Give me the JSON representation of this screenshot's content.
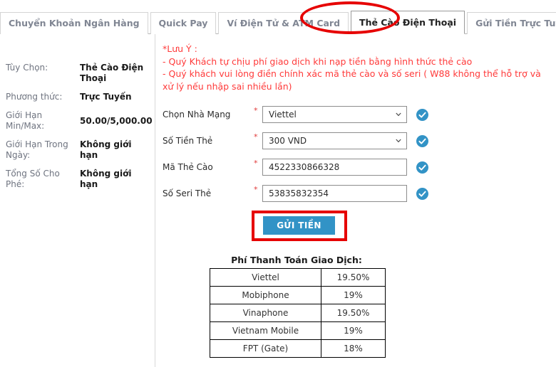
{
  "tabs": [
    {
      "label": "Chuyển Khoản Ngân Hàng",
      "active": false
    },
    {
      "label": "Quick Pay",
      "active": false
    },
    {
      "label": "Ví Điện Tử & ATM Card",
      "active": false
    },
    {
      "label": "Thẻ Cào Điện Thoại",
      "active": true
    },
    {
      "label": "Gửi Tiền Trực Tuyến",
      "active": false
    }
  ],
  "sidebar": {
    "rows": [
      {
        "label": "Tùy Chọn:",
        "value": "Thẻ Cào Điện Thoại"
      },
      {
        "label": "Phương thức:",
        "value": "Trực Tuyến"
      },
      {
        "label": "Giới Hạn Min/Max:",
        "value": "50.00/5,000.00"
      },
      {
        "label": "Giới Hạn Trong Ngày:",
        "value": "Không giới hạn"
      },
      {
        "label": "Tổng Số Cho Phé:",
        "value": "Không giới hạn"
      }
    ]
  },
  "notice": {
    "line1": "*Lưu Ý :",
    "line2": "- Quý Khách tự chịu phí giao dịch khi nạp tiền bằng hình thức thẻ cào",
    "line3": "- Quý khách vui lòng điền chính xác mã thẻ cào và số seri ( W88 không thể hỗ trợ và xử lý nếu nhập sai nhiều lần)"
  },
  "form": {
    "required_mark": "*",
    "fields": [
      {
        "label": "Chọn Nhà Mạng",
        "type": "select",
        "value": "Viettel",
        "valid": true
      },
      {
        "label": "Số Tiền Thẻ",
        "type": "select",
        "value": "300 VND",
        "valid": true
      },
      {
        "label": "Mã Thẻ Cào",
        "type": "text",
        "value": "4522330866328",
        "valid": true
      },
      {
        "label": "Số Seri Thẻ",
        "type": "text",
        "value": "53835832354",
        "valid": true
      }
    ],
    "submit_label": "GỬI TIỀN"
  },
  "fee_table": {
    "title": "Phí Thanh Toán Giao Dịch:",
    "rows": [
      {
        "name": "Viettel",
        "pct": "19.50%"
      },
      {
        "name": "Mobiphone",
        "pct": "19%"
      },
      {
        "name": "Vinaphone",
        "pct": "19.50%"
      },
      {
        "name": "Vietnam Mobile",
        "pct": "19%"
      },
      {
        "name": "FPT (Gate)",
        "pct": "18%"
      }
    ]
  },
  "colors": {
    "accent_blue": "#3293c6",
    "notice_red": "#ff3a3a",
    "annotation_red": "#e60000",
    "valid_badge": "#3293c6"
  }
}
